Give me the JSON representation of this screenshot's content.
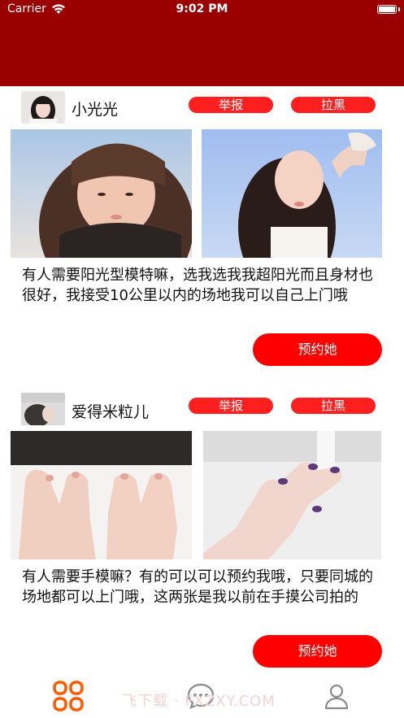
{
  "status_bar": {
    "carrier": "Carrier",
    "time": "9:02 PM"
  },
  "posts": [
    {
      "username": "小光光",
      "report_label": "举报",
      "block_label": "拉黑",
      "text": "有人需要阳光型模特嘛，选我选我我超阳光而且身材也很好，我接受10公里以内的场地我可以自己上门哦",
      "book_label": "预约她"
    },
    {
      "username": "爱得米粒儿",
      "report_label": "举报",
      "block_label": "拉黑",
      "text": "有人需要手模嘛？有的可以可以预约我哦，只要同城的场地都可以上门哦，这两张是我以前在手摸公司拍的",
      "book_label": "预约她"
    }
  ],
  "tab_bar": {
    "items": [
      "grid-icon",
      "chat-icon",
      "profile-icon"
    ],
    "active_index": 0,
    "active_color": "#ff5a00",
    "inactive_color": "#8a8a8a"
  },
  "watermark": "飞下载 · FXZXY.COM",
  "colors": {
    "header": "#9a0000",
    "accent": "#ff0000"
  }
}
